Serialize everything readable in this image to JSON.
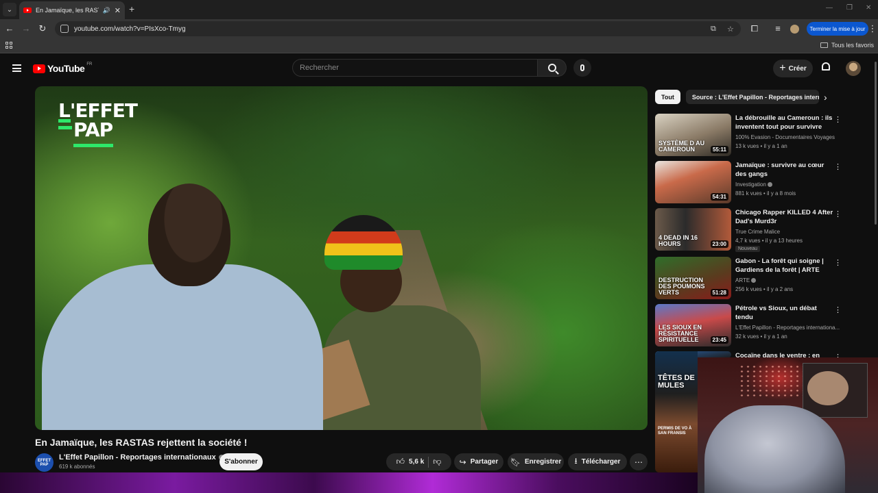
{
  "browser": {
    "tab_title": "En Jamaïque, les RASTAS re",
    "url": "youtube.com/watch?v=PIsXco-Tmyg",
    "update_button": "Terminer la mise à jour",
    "all_bookmarks": "Tous les favoris"
  },
  "youtube": {
    "logo_text": "YouTube",
    "logo_region": "FR",
    "search_placeholder": "Rechercher",
    "create_label": "Créer"
  },
  "player": {
    "brand_line1": "L'EFFET",
    "brand_line2": "PAP"
  },
  "video": {
    "title": "En Jamaïque, les RASTAS rejettent la société !",
    "channel_name": "L'Effet Papillon - Reportages internationaux",
    "channel_avatar_text": "EFFET PAP",
    "subscribers": "619 k abonnés",
    "subscribe_label": "S'abonner",
    "likes": "5,6 k",
    "share_label": "Partager",
    "save_label": "Enregistrer",
    "download_label": "Télécharger"
  },
  "sidebar": {
    "chips": [
      "Tout",
      "Source : L'Effet Papillon - Reportages interna"
    ],
    "recommendations": [
      {
        "title": "La débrouille au Cameroun : ils inventent tout pour survivre",
        "channel": "100% Evasion - Documentaires Voyages",
        "stats": "13 k vues • il y a 1 an",
        "duration": "55:11",
        "thumb_text": "SYSTÈME D AU CAMEROUN",
        "badge": "",
        "verified": false
      },
      {
        "title": "Jamaïque : survivre au cœur des gangs",
        "channel": "Investigation",
        "stats": "881 k vues • il y a 8 mois",
        "duration": "54:31",
        "thumb_text": "",
        "badge": "",
        "verified": true
      },
      {
        "title": "Chicago Rapper KILLED 4 After Dad's Murd3r",
        "channel": "True Crime Malice",
        "stats": "4,7 k vues • il y a 13 heures",
        "duration": "23:00",
        "thumb_text": "4 DEAD IN 16 HOURS",
        "badge": "Nouveau",
        "verified": false
      },
      {
        "title": "Gabon - La forêt qui soigne | Gardiens de la forêt | ARTE",
        "channel": "ARTE",
        "stats": "256 k vues • il y a 2 ans",
        "duration": "51:28",
        "thumb_text": "DESTRUCTION DES POUMONS VERTS",
        "badge": "",
        "verified": true
      },
      {
        "title": "Pétrole vs Sioux, un débat tendu",
        "channel": "L'Effet Papillon - Reportages internationa...",
        "stats": "32 k vues • il y a 1 an",
        "duration": "23:45",
        "thumb_text": "LES SIOUX EN RÉSISTANCE SPIRITUELLE",
        "badge": "",
        "verified": false
      },
      {
        "title": "Cocaïne dans le ventre : en",
        "channel": "",
        "stats": "",
        "duration": "",
        "thumb_text": "",
        "badge": "",
        "verified": false
      }
    ],
    "partial_thumb_text1": "TÊTES DE MULES",
    "partial_thumb_text2": "PERMIS DE VO À SAN FRANSIS"
  },
  "colors": {
    "background": "#0f0f0f",
    "accent_red": "#ff0000",
    "brand_green": "#2ee86a",
    "update_blue": "#0b57d0"
  }
}
